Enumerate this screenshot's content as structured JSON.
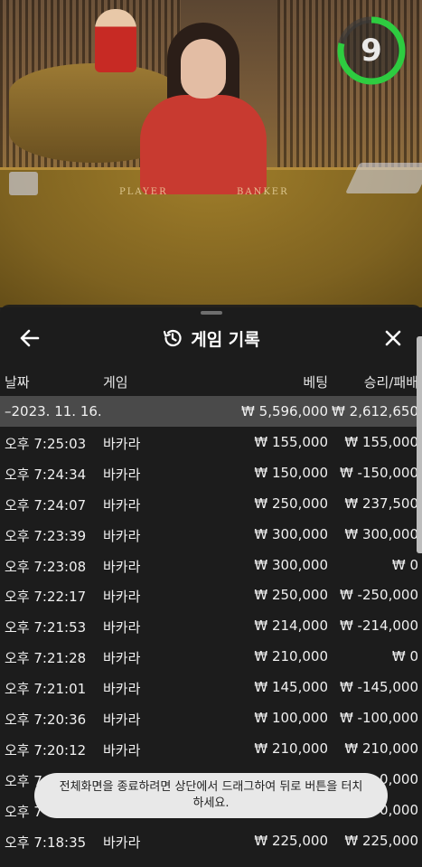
{
  "timer": {
    "value": "9",
    "ring_color": "#2ecc40"
  },
  "felt": {
    "player_label": "PLAYER",
    "banker_label": "BANKER"
  },
  "history": {
    "title": "게임 기록",
    "back_icon": "arrow-left-icon",
    "history_icon": "history-clock-icon",
    "close_icon": "close-x-icon",
    "columns": {
      "date": "날짜",
      "game": "게임",
      "bet": "베팅",
      "win_loss": "승리/패배"
    },
    "summary": {
      "date": "–2023. 11. 16.",
      "bet": "₩ 5,596,000",
      "win_loss": "₩ 2,612,650"
    },
    "rows": [
      {
        "time": "오후 7:25:03",
        "game": "바카라",
        "bet": "₩ 155,000",
        "win_loss": "₩ 155,000"
      },
      {
        "time": "오후 7:24:34",
        "game": "바카라",
        "bet": "₩ 150,000",
        "win_loss": "₩ -150,000"
      },
      {
        "time": "오후 7:24:07",
        "game": "바카라",
        "bet": "₩ 250,000",
        "win_loss": "₩ 237,500"
      },
      {
        "time": "오후 7:23:39",
        "game": "바카라",
        "bet": "₩ 300,000",
        "win_loss": "₩ 300,000"
      },
      {
        "time": "오후 7:23:08",
        "game": "바카라",
        "bet": "₩ 300,000",
        "win_loss": "₩ 0"
      },
      {
        "time": "오후 7:22:17",
        "game": "바카라",
        "bet": "₩ 250,000",
        "win_loss": "₩ -250,000"
      },
      {
        "time": "오후 7:21:53",
        "game": "바카라",
        "bet": "₩ 214,000",
        "win_loss": "₩ -214,000"
      },
      {
        "time": "오후 7:21:28",
        "game": "바카라",
        "bet": "₩ 210,000",
        "win_loss": "₩ 0"
      },
      {
        "time": "오후 7:21:01",
        "game": "바카라",
        "bet": "₩ 145,000",
        "win_loss": "₩ -145,000"
      },
      {
        "time": "오후 7:20:36",
        "game": "바카라",
        "bet": "₩ 100,000",
        "win_loss": "₩ -100,000"
      },
      {
        "time": "오후 7:20:12",
        "game": "바카라",
        "bet": "₩ 210,000",
        "win_loss": "₩ 210,000"
      },
      {
        "time": "오후 7",
        "game": "",
        "bet": "",
        "win_loss": "0,000"
      },
      {
        "time": "오후 7",
        "game": "",
        "bet": "",
        "win_loss": "0,000"
      },
      {
        "time": "오후 7:18:35",
        "game": "바카라",
        "bet": "₩ 225,000",
        "win_loss": "₩ 225,000"
      }
    ]
  },
  "toast": {
    "message": "전체화면을 종료하려면 상단에서 드래그하여 뒤로 버튼을 터치하세요."
  }
}
